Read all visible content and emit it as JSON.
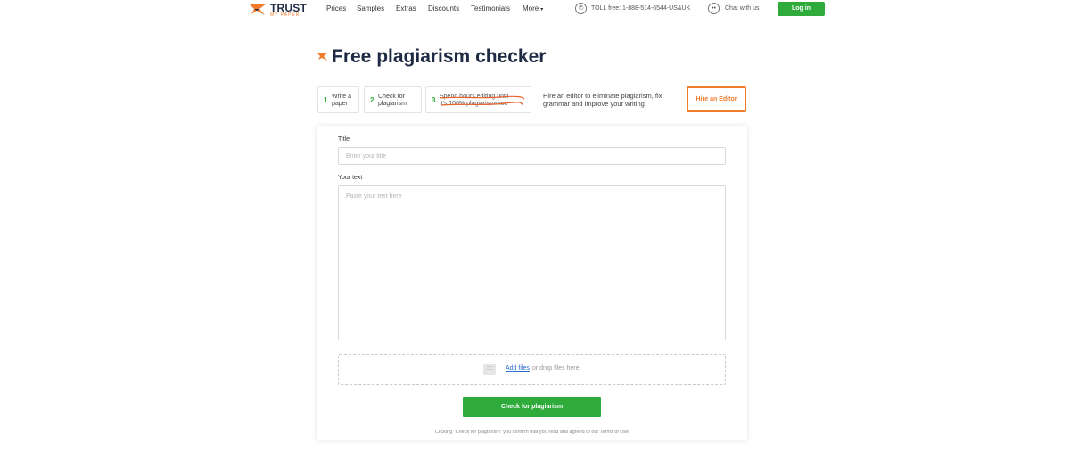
{
  "header": {
    "logo_text": "TRUST",
    "logo_subtext": "MY PAPER",
    "nav": [
      "Prices",
      "Samples",
      "Extras",
      "Discounts",
      "Testimonials",
      "More"
    ],
    "phone": "TOLL free: 1-888-514-6544-US&UK",
    "chat": "Chat with us",
    "login": "Log in"
  },
  "page": {
    "title": "Free plagiarism checker"
  },
  "steps": [
    {
      "number": "1",
      "text_line1": "Write a",
      "text_line2": "paper"
    },
    {
      "number": "2",
      "text_line1": "Check for",
      "text_line2": "plagiarism"
    },
    {
      "number": "3",
      "text_line1": "Spend hours editing until",
      "text_line2": "it's 100% plagiarism-free"
    }
  ],
  "hire": {
    "text": "Hire an editor to eliminate plagiarism, fix grammar and improve your writing",
    "button": "Hire an Editor"
  },
  "form": {
    "title_label": "Title",
    "title_placeholder": "Enter your title",
    "text_label": "Your text",
    "text_placeholder": "Paste your text here",
    "add_files": "Add files",
    "drop_text": "or drop files here",
    "submit": "Check for plagiarism",
    "terms": "Clicking \"Check for plagiarism\" you confirm that you read and agreed to our Terms of Use"
  },
  "colors": {
    "green": "#2eab3b",
    "orange": "#f07c2c",
    "navy": "#1f2a44"
  }
}
